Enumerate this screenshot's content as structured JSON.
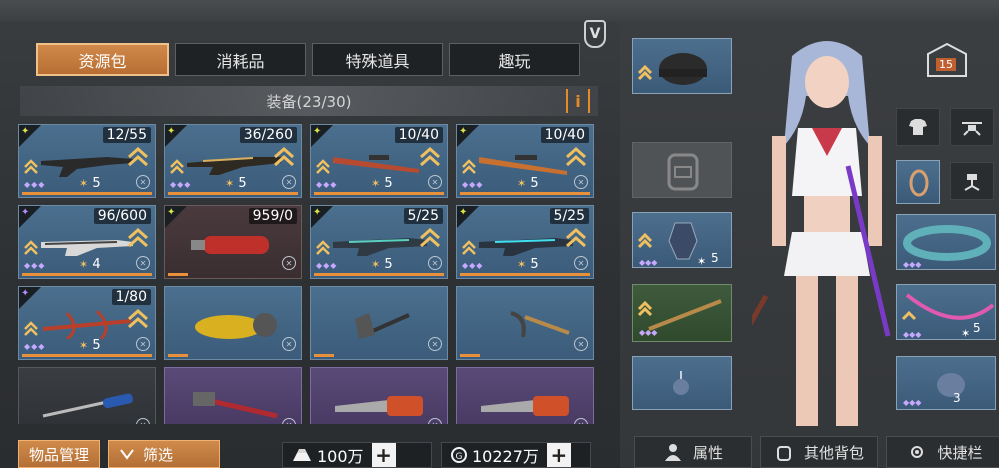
{
  "tabs": [
    {
      "label": "资源包",
      "active": true
    },
    {
      "label": "消耗品",
      "active": false
    },
    {
      "label": "特殊道具",
      "active": false
    },
    {
      "label": "趣玩",
      "active": false
    }
  ],
  "equip_header": {
    "label": "装备(23/30)",
    "info": "i"
  },
  "v_badge": "V",
  "items": [
    {
      "count": "12/55",
      "style": "blue",
      "level": "5",
      "weapon": "rifle-black"
    },
    {
      "count": "36/260",
      "style": "blue",
      "level": "5",
      "weapon": "rifle-gold"
    },
    {
      "count": "10/40",
      "style": "blue",
      "level": "5",
      "weapon": "sniper-red"
    },
    {
      "count": "10/40",
      "style": "blue",
      "level": "5",
      "weapon": "sniper-orange"
    },
    {
      "count": "96/600",
      "style": "blue",
      "level": "4",
      "weapon": "rifle-white"
    },
    {
      "count": "959/0",
      "style": "dark",
      "level": "",
      "weapon": "extinguisher"
    },
    {
      "count": "5/25",
      "style": "blue",
      "level": "5",
      "weapon": "rifle-teal"
    },
    {
      "count": "5/25",
      "style": "blue",
      "level": "5",
      "weapon": "rifle-cyan"
    },
    {
      "count": "1/80",
      "style": "blue",
      "level": "5",
      "weapon": "crossbow"
    },
    {
      "count": "",
      "style": "blue",
      "level": "",
      "weapon": "scooter"
    },
    {
      "count": "",
      "style": "blue",
      "level": "",
      "weapon": "axe"
    },
    {
      "count": "",
      "style": "blue",
      "level": "",
      "weapon": "pickaxe"
    },
    {
      "count": "",
      "style": "gray",
      "level": "",
      "weapon": "screwdriver"
    },
    {
      "count": "",
      "style": "purple",
      "level": "",
      "weapon": "hammer"
    },
    {
      "count": "",
      "style": "purple",
      "level": "",
      "weapon": "chainsaw"
    },
    {
      "count": "",
      "style": "purple",
      "level": "",
      "weapon": "chainsaw"
    }
  ],
  "bottom_buttons": {
    "manage": "物品管理",
    "filter": "筛选"
  },
  "currency": {
    "coins": "100万",
    "gems": "10227万"
  },
  "right_slots": {
    "helmet_level": "",
    "chest_level": "5",
    "bracelet_level": "5",
    "ring_level": "3",
    "level_badge": "15"
  },
  "bottom_tabs": [
    {
      "label": "属性"
    },
    {
      "label": "其他背包"
    },
    {
      "label": "快捷栏"
    }
  ]
}
